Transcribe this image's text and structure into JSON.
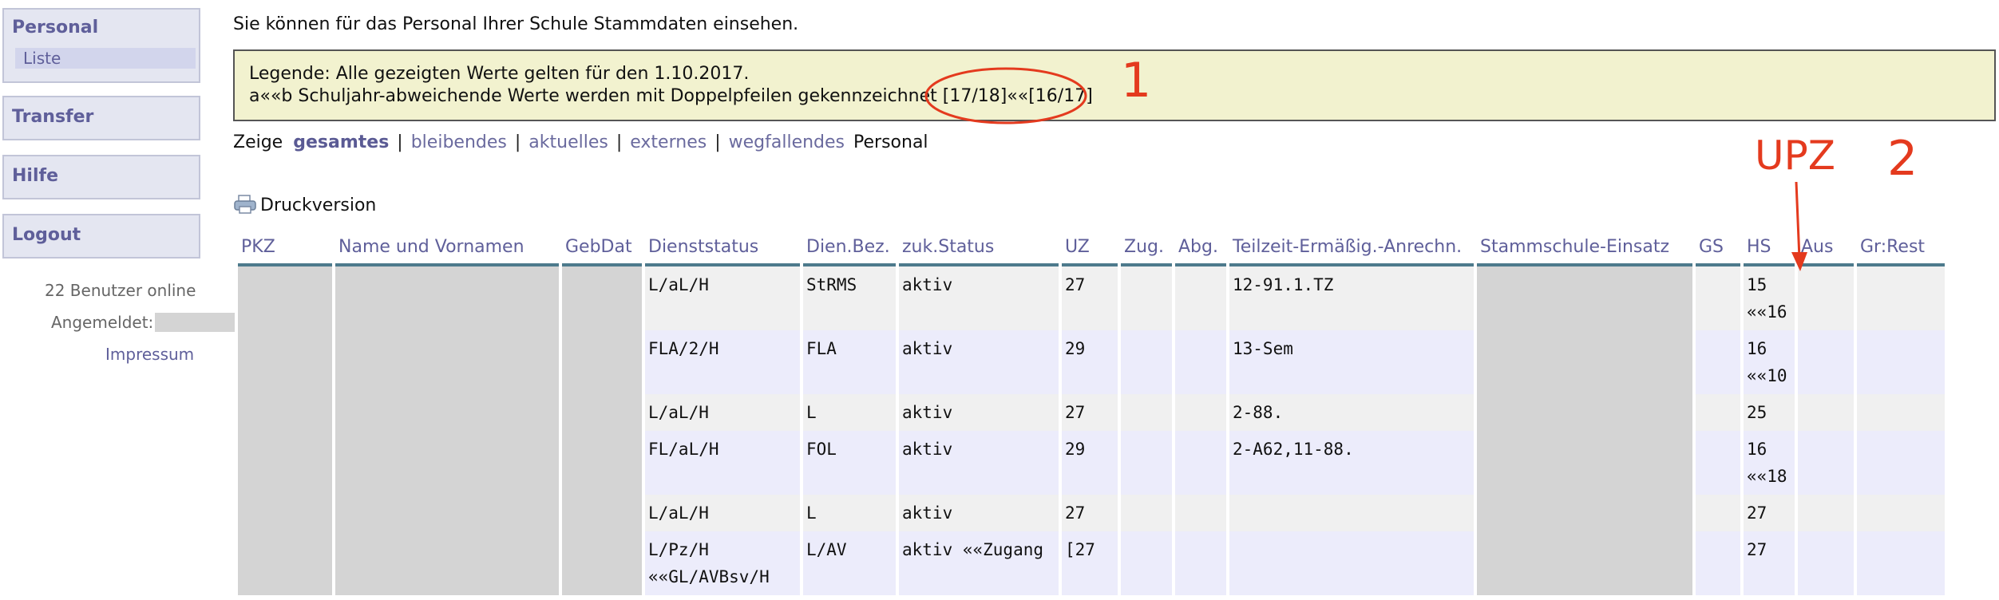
{
  "sidebar": {
    "personal": {
      "label": "Personal",
      "sub_item": "Liste"
    },
    "transfer": "Transfer",
    "hilfe": "Hilfe",
    "logout": "Logout",
    "online_count": "22 Benutzer online",
    "logged_in_label": "Angemeldet:",
    "impressum": "Impressum"
  },
  "intro": "Sie können für das Personal Ihrer Schule Stammdaten einsehen.",
  "legend": {
    "line1": "Legende: Alle gezeigten Werte gelten für den 1.10.2017.",
    "line2": "a««b Schuljahr-abweichende Werte werden mit Doppelpfeilen gekennzeichnet [17/18]««[16/17]"
  },
  "filter": {
    "prefix": "Zeige",
    "options": [
      "gesamtes",
      "bleibendes",
      "aktuelles",
      "externes",
      "wegfallendes"
    ],
    "separator": "|",
    "suffix": "Personal"
  },
  "print_label": "Druckversion",
  "table": {
    "headers": [
      "PKZ",
      "Name und Vornamen",
      "GebDat",
      "Dienststatus",
      "Dien.Bez.",
      "zuk.Status",
      "UZ",
      "Zug.",
      "Abg.",
      "Teilzeit-Ermäßig.-Anrechn.",
      "Stammschule-Einsatz",
      "GS",
      "HS",
      "Aus",
      "Gr:Rest"
    ],
    "rows": [
      {
        "dienststatus": [
          "L/aL/H"
        ],
        "dienbez": "StRMS",
        "status": "aktiv",
        "uz": "27",
        "teilzeit": "12-91.1.TZ",
        "hs": [
          "15",
          "««16"
        ]
      },
      {
        "dienststatus": [
          "FLA/2/H"
        ],
        "dienbez": "FLA",
        "status": "aktiv",
        "uz": "29",
        "teilzeit": "13-Sem",
        "hs": [
          "16",
          "««10"
        ]
      },
      {
        "dienststatus": [
          "L/aL/H"
        ],
        "dienbez": "L",
        "status": "aktiv",
        "uz": "27",
        "teilzeit": "2-88.",
        "hs": [
          "25"
        ]
      },
      {
        "dienststatus": [
          "FL/aL/H"
        ],
        "dienbez": "FOL",
        "status": "aktiv",
        "uz": "29",
        "teilzeit": "2-A62,11-88.",
        "hs": [
          "16",
          "««18"
        ]
      },
      {
        "dienststatus": [
          "L/aL/H"
        ],
        "dienbez": "L",
        "status": "aktiv",
        "uz": "27",
        "teilzeit": "",
        "hs": [
          "27"
        ]
      },
      {
        "dienststatus": [
          "L/Pz/H",
          "««GL/AVBsv/H"
        ],
        "dienbez": "L/AV",
        "status": "aktiv ««Zugang",
        "uz": "[27",
        "teilzeit": "",
        "hs": [
          "27"
        ]
      }
    ]
  },
  "annotations": {
    "label_1": "1",
    "label_2": "2",
    "label_upz": "UPZ",
    "color": "#e43a1e"
  }
}
